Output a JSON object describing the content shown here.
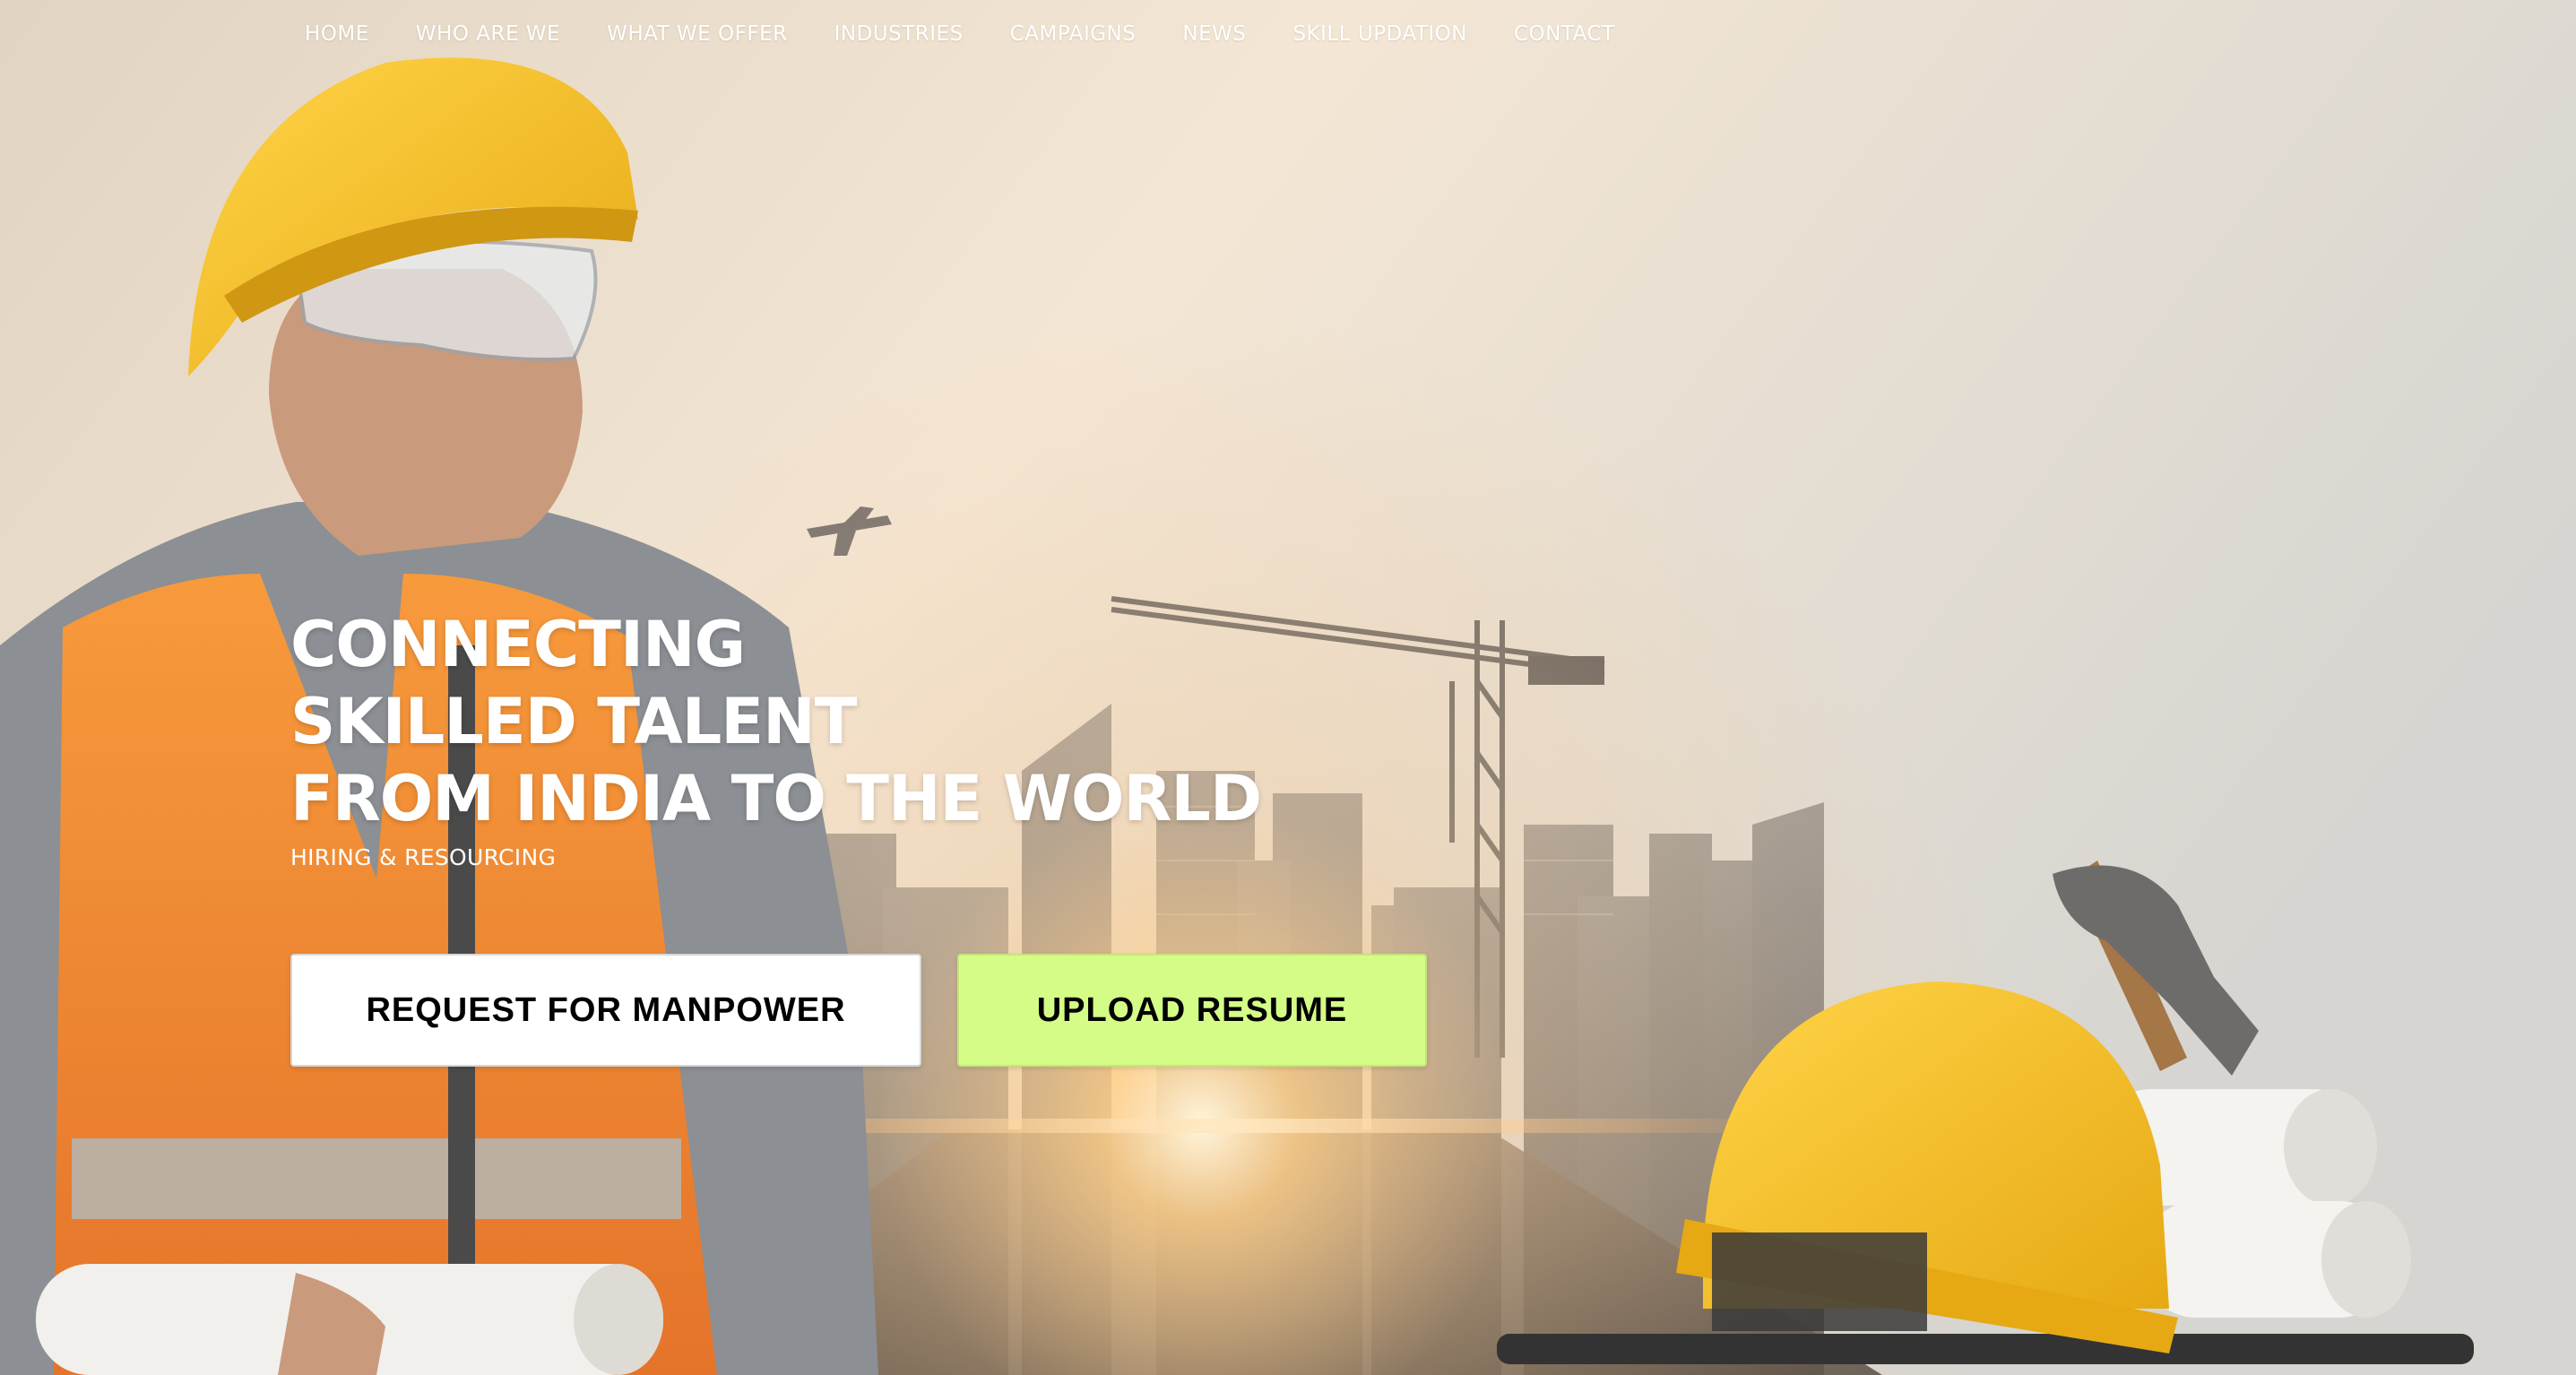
{
  "nav": {
    "items": [
      {
        "label": "HOME"
      },
      {
        "label": "WHO ARE WE"
      },
      {
        "label": "WHAT WE OFFER"
      },
      {
        "label": "INDUSTRIES"
      },
      {
        "label": "CAMPAIGNS"
      },
      {
        "label": "NEWS"
      },
      {
        "label": "SKILL UPDATION"
      },
      {
        "label": "CONTACT"
      }
    ]
  },
  "hero": {
    "headline_lines": [
      "CONNECTING",
      "SKILLED TALENT",
      "FROM INDIA TO THE WORLD"
    ],
    "subtitle": "HIRING & RESOURCING",
    "primary_button": "REQUEST FOR MANPOWER",
    "secondary_button": "UPLOAD RESUME"
  },
  "colors": {
    "text_on_hero": "#ffffff",
    "primary_button_bg": "#ffffff",
    "secondary_button_bg": "#d4fc86",
    "button_text": "#000000"
  },
  "icons": {
    "hero_image": "construction-worker-city-skyline-image"
  }
}
